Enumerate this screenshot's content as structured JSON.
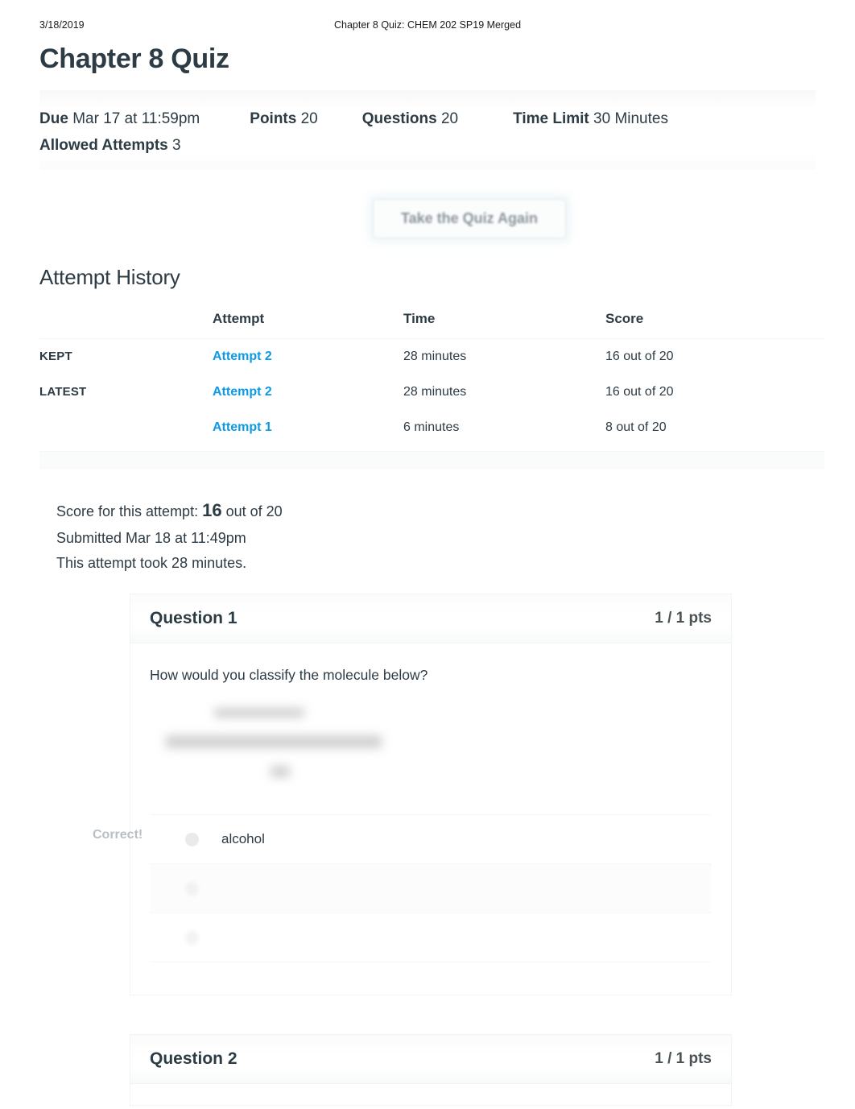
{
  "print_header": {
    "date": "3/18/2019",
    "document_title": "Chapter 8 Quiz: CHEM 202 SP19 Merged"
  },
  "quiz": {
    "title": "Chapter 8 Quiz",
    "details": [
      {
        "label": "Due",
        "value": "Mar 17 at 11:59pm"
      },
      {
        "label": "Points",
        "value": "20"
      },
      {
        "label": "Questions",
        "value": "20"
      },
      {
        "label": "Time Limit",
        "value": "30 Minutes"
      },
      {
        "label": "Allowed Attempts",
        "value": "3"
      }
    ],
    "retake_button_label": "Take the Quiz Again"
  },
  "attempt_history": {
    "heading": "Attempt History",
    "columns": [
      "",
      "Attempt",
      "Time",
      "Score"
    ],
    "rows": [
      {
        "flag": "KEPT",
        "attempt": "Attempt 2",
        "time": "28 minutes",
        "score": "16 out of 20"
      },
      {
        "flag": "LATEST",
        "attempt": "Attempt 2",
        "time": "28 minutes",
        "score": "16 out of 20"
      },
      {
        "flag": "",
        "attempt": "Attempt 1",
        "time": "6 minutes",
        "score": "8 out of 20"
      }
    ]
  },
  "attempt_summary": {
    "score_prefix": "Score for this attempt:",
    "score_value": "16",
    "score_suffix": "out of 20",
    "submitted": "Submitted Mar 18 at 11:49pm",
    "duration": "This attempt took 28 minutes."
  },
  "questions": [
    {
      "name": "Question 1",
      "points": "1 / 1 pts",
      "text": "How would you classify the molecule below?",
      "has_image": true,
      "image_alt": "molecule structure diagram",
      "result_flag": "Correct!",
      "answers": [
        {
          "text": "alcohol",
          "selected": true,
          "visible": true
        },
        {
          "text": "",
          "selected": false,
          "visible": false
        },
        {
          "text": "",
          "selected": false,
          "visible": false
        }
      ]
    },
    {
      "name": "Question 2",
      "points": "1 / 1 pts",
      "text": "",
      "has_image": false,
      "result_flag": "",
      "answers": []
    }
  ],
  "colors": {
    "link": "#0d9ae5",
    "text": "#2d3b45",
    "muted": "#b9bfc3"
  }
}
